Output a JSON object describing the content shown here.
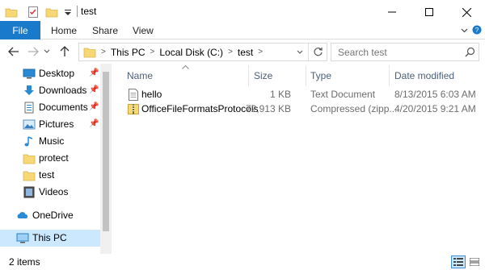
{
  "window": {
    "title": "test"
  },
  "ribbon": {
    "tabs": [
      {
        "label": "File"
      },
      {
        "label": "Home"
      },
      {
        "label": "Share"
      },
      {
        "label": "View"
      }
    ]
  },
  "address": {
    "crumbs": [
      "This PC",
      "Local Disk (C:)",
      "test"
    ]
  },
  "search": {
    "placeholder": "Search test"
  },
  "nav": {
    "items": [
      {
        "label": "Desktop",
        "icon": "desktop-icon",
        "pinned": true
      },
      {
        "label": "Downloads",
        "icon": "downloads-icon",
        "pinned": true
      },
      {
        "label": "Documents",
        "icon": "documents-icon",
        "pinned": true
      },
      {
        "label": "Pictures",
        "icon": "pictures-icon",
        "pinned": true
      },
      {
        "label": "Music",
        "icon": "music-icon",
        "pinned": false
      },
      {
        "label": "protect",
        "icon": "folder-icon",
        "pinned": false
      },
      {
        "label": "test",
        "icon": "folder-icon",
        "pinned": false
      },
      {
        "label": "Videos",
        "icon": "videos-icon",
        "pinned": false
      },
      {
        "label": "OneDrive",
        "icon": "onedrive-icon",
        "pinned": false
      },
      {
        "label": "This PC",
        "icon": "this-pc-icon",
        "pinned": false,
        "selected": true
      }
    ]
  },
  "columns": {
    "name": "Name",
    "size": "Size",
    "type": "Type",
    "date": "Date modified"
  },
  "files": [
    {
      "name": "hello",
      "icon": "text-file-icon",
      "size": "1 KB",
      "type": "Text Document",
      "date": "8/13/2015 6:03 AM"
    },
    {
      "name": "OfficeFileFormatsProtocols",
      "icon": "zip-folder-icon",
      "size": "72,913 KB",
      "type": "Compressed (zipp...",
      "date": "4/20/2015 9:21 AM"
    }
  ],
  "status": {
    "items_count": "2 items"
  },
  "colors": {
    "accent": "#1979ca",
    "selection": "#cce8ff",
    "folder": "#f8d775",
    "header_text": "#4c607a"
  }
}
